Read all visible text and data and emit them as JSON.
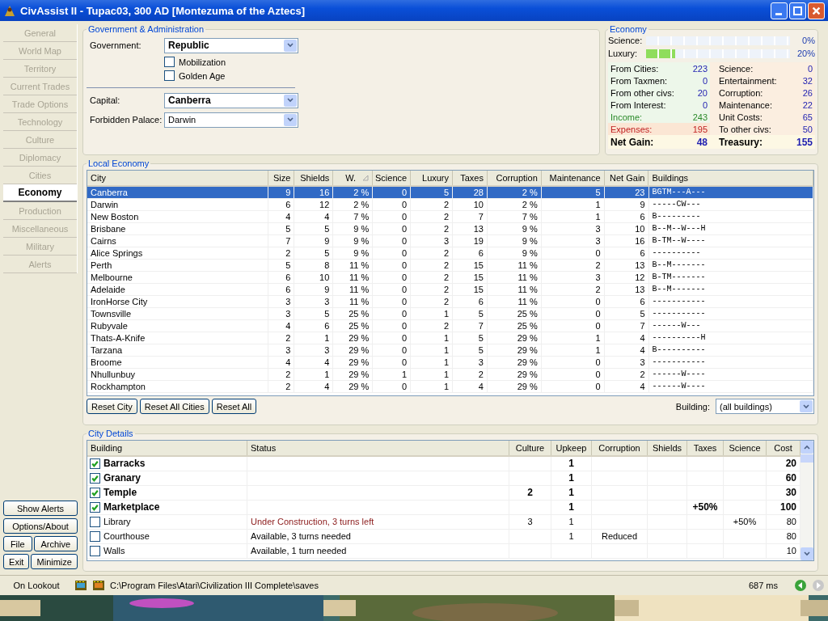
{
  "window": {
    "title": "CivAssist II - Tupac03, 300 AD [Montezuma of the Aztecs]"
  },
  "nav": [
    {
      "label": "General",
      "selected": false
    },
    {
      "label": "World Map",
      "selected": false
    },
    {
      "label": "Territory",
      "selected": false
    },
    {
      "label": "Current Trades",
      "selected": false
    },
    {
      "label": "Trade Options",
      "selected": false
    },
    {
      "label": "Technology",
      "selected": false
    },
    {
      "label": "Culture",
      "selected": false
    },
    {
      "label": "Diplomacy",
      "selected": false
    },
    {
      "label": "Cities",
      "selected": false
    },
    {
      "label": "Economy",
      "selected": true
    },
    {
      "label": "Production",
      "selected": false
    },
    {
      "label": "Miscellaneous",
      "selected": false
    },
    {
      "label": "Military",
      "selected": false
    },
    {
      "label": "Alerts",
      "selected": false
    }
  ],
  "side_buttons": [
    [
      "Show Alerts"
    ],
    [
      "Options/About"
    ],
    [
      "File",
      "Archive"
    ],
    [
      "Exit",
      "Minimize"
    ]
  ],
  "government": {
    "title": "Government & Administration",
    "government": {
      "label": "Government:",
      "value": "Republic",
      "bold": true
    },
    "options": [
      {
        "label": "Mobilization",
        "checked": false
      },
      {
        "label": "Golden Age",
        "checked": false
      }
    ],
    "capital": {
      "label": "Capital:",
      "value": "Canberra",
      "bold": true
    },
    "forbidden_palace": {
      "label": "Forbidden Palace:",
      "value": "Darwin",
      "bold": false
    }
  },
  "economy": {
    "title": "Economy",
    "rates": [
      {
        "label": "Science:",
        "level": 0,
        "reading": "0%"
      },
      {
        "label": "Luxury:",
        "level": 0.2,
        "reading": "20%"
      }
    ],
    "income": [
      {
        "label": "From Cities:",
        "value": "223"
      },
      {
        "label": "From Taxmen:",
        "value": "0"
      },
      {
        "label": "From other civs:",
        "value": "20"
      },
      {
        "label": "From Interest:",
        "value": "0"
      }
    ],
    "income_total": {
      "label": "Income:",
      "value": "243"
    },
    "expenses_total": {
      "label": "Expenses:",
      "value": "195"
    },
    "expenses": [
      {
        "label": "Science:",
        "value": "0"
      },
      {
        "label": "Entertainment:",
        "value": "32"
      },
      {
        "label": "Corruption:",
        "value": "26"
      },
      {
        "label": "Maintenance:",
        "value": "22"
      },
      {
        "label": "Unit Costs:",
        "value": "65"
      },
      {
        "label": "To other civs:",
        "value": "50"
      }
    ],
    "net_gain": {
      "label": "Net Gain:",
      "value": "48"
    },
    "treasury": {
      "label": "Treasury:",
      "value": "155"
    }
  },
  "local_economy": {
    "title": "Local Economy",
    "columns": [
      {
        "label": "City",
        "sorted": false
      },
      {
        "label": "Size",
        "sorted": false
      },
      {
        "label": "Shields",
        "sorted": false
      },
      {
        "label": "W.",
        "sorted": true
      },
      {
        "label": "Science",
        "sorted": false
      },
      {
        "label": "Luxury",
        "sorted": false
      },
      {
        "label": "Taxes",
        "sorted": false
      },
      {
        "label": "Corruption",
        "sorted": false
      },
      {
        "label": "Maintenance",
        "sorted": false
      },
      {
        "label": "Net Gain",
        "sorted": false
      },
      {
        "label": "Buildings",
        "sorted": false
      }
    ],
    "rows": [
      {
        "selected": true,
        "cells": [
          "Canberra",
          "9",
          "16",
          "2 %",
          "0",
          "5",
          "28",
          "2 %",
          "5",
          "23",
          "BGTM---A---"
        ]
      },
      {
        "selected": false,
        "cells": [
          "Darwin",
          "6",
          "12",
          "2 %",
          "0",
          "2",
          "10",
          "2 %",
          "1",
          "9",
          "-----CW---"
        ]
      },
      {
        "selected": false,
        "cells": [
          "New Boston",
          "4",
          "4",
          "7 %",
          "0",
          "2",
          "7",
          "7 %",
          "1",
          "6",
          "B---------"
        ]
      },
      {
        "selected": false,
        "cells": [
          "Brisbane",
          "5",
          "5",
          "9 %",
          "0",
          "2",
          "13",
          "9 %",
          "3",
          "10",
          "B--M--W---H"
        ]
      },
      {
        "selected": false,
        "cells": [
          "Cairns",
          "7",
          "9",
          "9 %",
          "0",
          "3",
          "19",
          "9 %",
          "3",
          "16",
          "B-TM--W----"
        ]
      },
      {
        "selected": false,
        "cells": [
          "Alice Springs",
          "2",
          "5",
          "9 %",
          "0",
          "2",
          "6",
          "9 %",
          "0",
          "6",
          "----------"
        ]
      },
      {
        "selected": false,
        "cells": [
          "Perth",
          "5",
          "8",
          "11 %",
          "0",
          "2",
          "15",
          "11 %",
          "2",
          "13",
          "B--M-------"
        ]
      },
      {
        "selected": false,
        "cells": [
          "Melbourne",
          "6",
          "10",
          "11 %",
          "0",
          "2",
          "15",
          "11 %",
          "3",
          "12",
          "B-TM-------"
        ]
      },
      {
        "selected": false,
        "cells": [
          "Adelaide",
          "6",
          "9",
          "11 %",
          "0",
          "2",
          "15",
          "11 %",
          "2",
          "13",
          "B--M-------"
        ]
      },
      {
        "selected": false,
        "cells": [
          "IronHorse City",
          "3",
          "3",
          "11 %",
          "0",
          "2",
          "6",
          "11 %",
          "0",
          "6",
          "-----------"
        ]
      },
      {
        "selected": false,
        "cells": [
          "Townsville",
          "3",
          "5",
          "25 %",
          "0",
          "1",
          "5",
          "25 %",
          "0",
          "5",
          "-----------"
        ]
      },
      {
        "selected": false,
        "cells": [
          "Rubyvale",
          "4",
          "6",
          "25 %",
          "0",
          "2",
          "7",
          "25 %",
          "0",
          "7",
          "------W---"
        ]
      },
      {
        "selected": false,
        "cells": [
          "Thats-A-Knife",
          "2",
          "1",
          "29 %",
          "0",
          "1",
          "5",
          "29 %",
          "1",
          "4",
          "----------H"
        ]
      },
      {
        "selected": false,
        "cells": [
          "Tarzana",
          "3",
          "3",
          "29 %",
          "0",
          "1",
          "5",
          "29 %",
          "1",
          "4",
          "B----------"
        ]
      },
      {
        "selected": false,
        "cells": [
          "Broome",
          "4",
          "4",
          "29 %",
          "0",
          "1",
          "3",
          "29 %",
          "0",
          "3",
          "-----------"
        ]
      },
      {
        "selected": false,
        "cells": [
          "Nhullunbuy",
          "2",
          "1",
          "29 %",
          "1",
          "1",
          "2",
          "29 %",
          "0",
          "2",
          "------W----"
        ]
      },
      {
        "selected": false,
        "cells": [
          "Rockhampton",
          "2",
          "4",
          "29 %",
          "0",
          "1",
          "4",
          "29 %",
          "0",
          "4",
          "------W----"
        ]
      }
    ],
    "buttons": [
      "Reset City",
      "Reset All Cities",
      "Reset All"
    ],
    "building_filter": {
      "label": "Building:",
      "value": "(all buildings)"
    }
  },
  "city_details": {
    "title": "City Details",
    "columns": [
      "Building",
      "Status",
      "Culture",
      "Upkeep",
      "Corruption",
      "Shields",
      "Taxes",
      "Science",
      "Cost"
    ],
    "rows": [
      {
        "checked": true,
        "kind": "built",
        "cells": [
          "Barracks",
          "",
          "",
          "1",
          "",
          "",
          "",
          "",
          "20"
        ]
      },
      {
        "checked": true,
        "kind": "built",
        "cells": [
          "Granary",
          "",
          "",
          "1",
          "",
          "",
          "",
          "",
          "60"
        ]
      },
      {
        "checked": true,
        "kind": "built",
        "cells": [
          "Temple",
          "",
          "2",
          "1",
          "",
          "",
          "",
          "",
          "30"
        ]
      },
      {
        "checked": true,
        "kind": "built",
        "cells": [
          "Marketplace",
          "",
          "",
          "1",
          "",
          "",
          "+50%",
          "",
          "100"
        ]
      },
      {
        "checked": false,
        "kind": "building",
        "cells": [
          "Library",
          "Under Construction, 3 turns left",
          "3",
          "1",
          "",
          "",
          "",
          "+50%",
          "80"
        ]
      },
      {
        "checked": false,
        "kind": "available",
        "cells": [
          "Courthouse",
          "Available, 3 turns needed",
          "",
          "1",
          "Reduced",
          "",
          "",
          "",
          "80"
        ]
      },
      {
        "checked": false,
        "kind": "available",
        "cells": [
          "Walls",
          "Available, 1 turn needed",
          "",
          "",
          "",
          "",
          "",
          "",
          "10"
        ]
      }
    ]
  },
  "status_bar": {
    "mode": "On Lookout",
    "path": "C:\\Program Files\\Atari\\Civilization III Complete\\saves",
    "timing": "687 ms"
  },
  "background": {
    "kind": "picture"
  }
}
